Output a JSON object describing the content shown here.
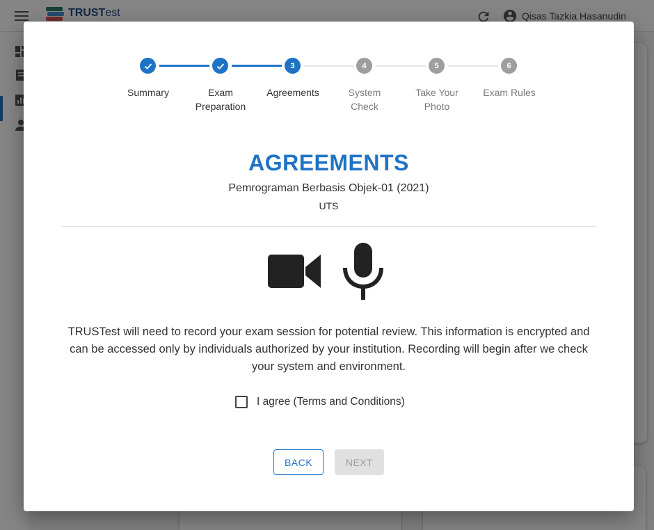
{
  "app": {
    "brand_prefix": "TRUST",
    "brand_suffix": "est",
    "user_name": "Qisas Tazkia Hasanudin",
    "icons": [
      "menu-icon",
      "logo-icon",
      "refresh-icon",
      "account-icon",
      "dashboard-icon",
      "exam-icon",
      "report-icon",
      "person-icon"
    ]
  },
  "stepper": {
    "steps": [
      {
        "number": "1",
        "label_line1": "Summary",
        "label_line2": "",
        "state": "done"
      },
      {
        "number": "2",
        "label_line1": "Exam",
        "label_line2": "Preparation",
        "state": "done"
      },
      {
        "number": "3",
        "label_line1": "Agreements",
        "label_line2": "",
        "state": "active"
      },
      {
        "number": "4",
        "label_line1": "System",
        "label_line2": "Check",
        "state": "todo"
      },
      {
        "number": "5",
        "label_line1": "Take Your",
        "label_line2": "Photo",
        "state": "todo"
      },
      {
        "number": "6",
        "label_line1": "Exam Rules",
        "label_line2": "",
        "state": "todo"
      }
    ]
  },
  "content": {
    "title": "AGREEMENTS",
    "course": "Pemrograman Berbasis Objek-01 (2021)",
    "exam_type": "UTS",
    "icons": [
      "camera-icon",
      "microphone-icon"
    ],
    "notice": "TRUSTest will need to record your exam session for potential review. This information is encrypted and can be accessed only by individuals authorized by your institution. Recording will begin after we check your system and environment.",
    "agree_label": "I agree (Terms and Conditions)",
    "agree_checked": false
  },
  "actions": {
    "back_label": "BACK",
    "next_label": "NEXT",
    "next_disabled": true
  },
  "colors": {
    "accent": "#1f73c4",
    "inactive_step": "#9e9e9e",
    "disabled_button": "#e0e0e0"
  }
}
